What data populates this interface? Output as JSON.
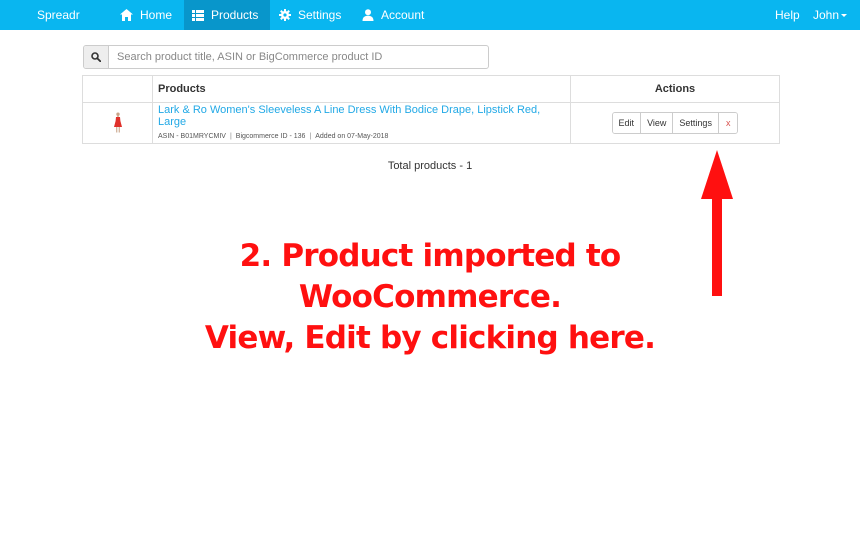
{
  "nav": {
    "brand": "Spreadr",
    "items": [
      {
        "label": "Home",
        "icon": "home-icon"
      },
      {
        "label": "Products",
        "icon": "list-icon",
        "active": true
      },
      {
        "label": "Settings",
        "icon": "gear-icon"
      },
      {
        "label": "Account",
        "icon": "user-icon"
      }
    ],
    "help": "Help",
    "user": "John"
  },
  "search": {
    "placeholder": "Search product title, ASIN or BigCommerce product ID",
    "value": ""
  },
  "table": {
    "headers": {
      "products": "Products",
      "actions": "Actions"
    },
    "rows": [
      {
        "title": "Lark & Ro Women's Sleeveless A Line Dress With Bodice Drape, Lipstick Red, Large",
        "asin": "ASIN - B01MRYCMIV",
        "bigcommerce_id": "Bigcommerce ID - 136",
        "added": "Added on 07-May-2018",
        "actions": {
          "edit": "Edit",
          "view": "View",
          "settings": "Settings",
          "delete": "x"
        }
      }
    ]
  },
  "total": "Total products - 1",
  "annotation": {
    "line1": "2. Product imported to WooCommerce.",
    "line2": "View, Edit by clicking here."
  },
  "colors": {
    "navbar": "#09b6f0",
    "navbar_active": "#0896cb",
    "link": "#22a9e6",
    "annotation": "#ff1010",
    "delete": "#d9534f"
  }
}
